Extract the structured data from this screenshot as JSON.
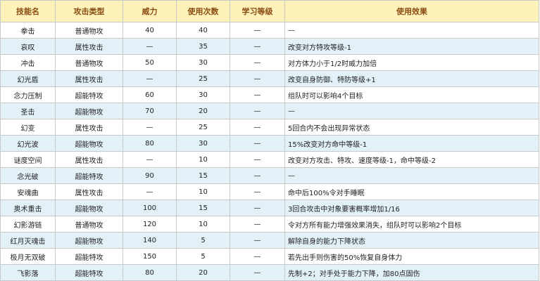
{
  "headers": [
    "技能名",
    "攻击类型",
    "威力",
    "使用次数",
    "学习等级",
    "使用效果"
  ],
  "rows": [
    [
      "拳击",
      "普通物攻",
      "40",
      "40",
      "—",
      "—"
    ],
    [
      "哀叹",
      "属性攻击",
      "—",
      "35",
      "—",
      "改变对方特攻等级-1"
    ],
    [
      "冲击",
      "普通物攻",
      "50",
      "30",
      "—",
      "对方体力小于1/2时威力加倍"
    ],
    [
      "幻光盾",
      "属性攻击",
      "—",
      "25",
      "—",
      "改变自身防御、特防等级+1"
    ],
    [
      "念力压制",
      "超能特攻",
      "60",
      "30",
      "—",
      "组队时可以影响4个目标"
    ],
    [
      "圣击",
      "超能物攻",
      "70",
      "20",
      "—",
      "—"
    ],
    [
      "幻变",
      "属性攻击",
      "—",
      "25",
      "—",
      "5回合内不会出现异常状态"
    ],
    [
      "幻光波",
      "超能物攻",
      "80",
      "30",
      "—",
      "15%改变对方命中等级-1"
    ],
    [
      "谜度空间",
      "属性攻击",
      "—",
      "10",
      "—",
      "改变对方攻击、特攻、速度等级-1，命中等级-2"
    ],
    [
      "念光破",
      "超能特攻",
      "90",
      "15",
      "—",
      "—"
    ],
    [
      "安魂曲",
      "属性攻击",
      "—",
      "10",
      "—",
      "命中后100%令对手睡眠"
    ],
    [
      "奥术重击",
      "超能物攻",
      "100",
      "15",
      "—",
      "3回合攻击中对象要害概率增加1/16"
    ],
    [
      "幻影游链",
      "普通物攻",
      "120",
      "10",
      "—",
      "令对方所有能力增强效果消失，组队时可以影响2个目标"
    ],
    [
      "红月灭魂击",
      "超能物攻",
      "140",
      "5",
      "—",
      "解除自身的能力下降状态"
    ],
    [
      "极月无双破",
      "超能特攻",
      "150",
      "5",
      "—",
      "若先出手则伤害的50%恢复自身体力"
    ],
    [
      "飞影落",
      "超能特攻",
      "80",
      "20",
      "—",
      "先制+2；对手处于能力下降，加80点固伤"
    ]
  ]
}
